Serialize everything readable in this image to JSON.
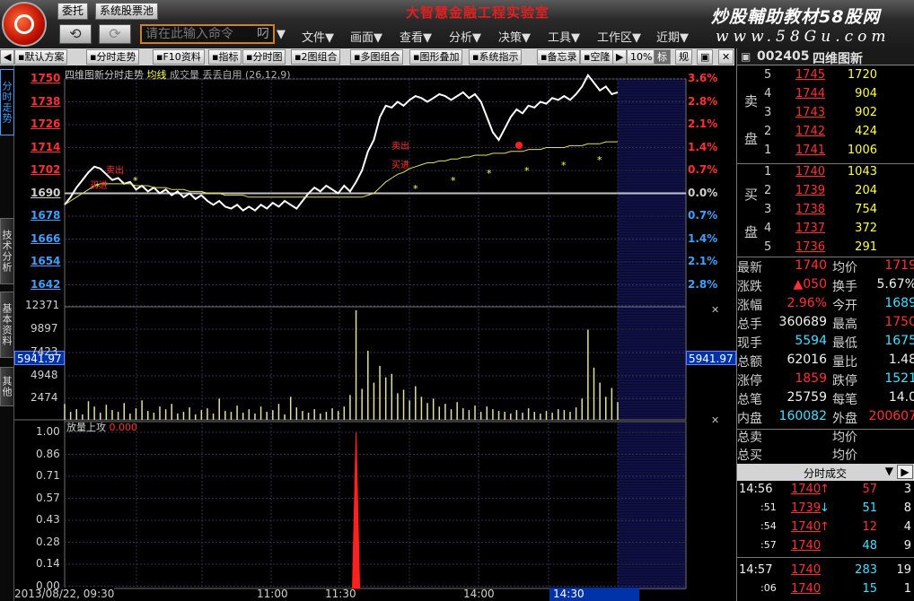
{
  "app": {
    "title": "大智慧金融工程实验室",
    "brand_cn": "炒股輔助教材58股网",
    "brand_url": "www.58Gu.com",
    "top_buttons": [
      "委托",
      "系统股票池"
    ],
    "command_placeholder": "请在此输入命令",
    "command_suffix": "叼",
    "menu": [
      "文件▼",
      "画面▼",
      "查看▼",
      "分析▼",
      "决策▼",
      "工具▼",
      "工作区▼",
      "近期▼"
    ]
  },
  "toolbar": {
    "items": [
      "默认方案",
      "分时走势",
      "F10资料",
      "指标",
      "分时图",
      "2图组合",
      "多图组合",
      "图形叠加",
      "系统指示",
      "备忘录",
      "空隆",
      "10%",
      "标",
      "规"
    ]
  },
  "vtabs": [
    "分时走势",
    "技术分析",
    "基本资料",
    "其他"
  ],
  "chart": {
    "header": {
      "title": "四维图新分时走势",
      "avg_label": "均线",
      "vol_label": "成交量",
      "indicator": "丢丢自用 (26,12,9)"
    },
    "price_labels": [
      "1750",
      "1738",
      "1726",
      "1714",
      "1702",
      "1690",
      "1678",
      "1666",
      "1654",
      "1642"
    ],
    "pct_labels": [
      "3.6%",
      "2.8%",
      "2.1%",
      "1.4%",
      "0.7%",
      "0.0%",
      "0.7%",
      "1.4%",
      "2.1%",
      "2.8%"
    ],
    "vol_labels": [
      "12371",
      "9897",
      "7423",
      "4948",
      "2474"
    ],
    "cursor_vol": "5941.97",
    "indicator_name": "放量上攻",
    "indicator_value": "0.000",
    "ind_labels": [
      "1.00",
      "0.86",
      "0.71",
      "0.57",
      "0.43",
      "0.28",
      "0.14",
      "0.00"
    ],
    "time_labels": [
      "2013/08/22, 09:30",
      "11:00",
      "11:30",
      "14:00",
      "14:30"
    ],
    "trade_marks": [
      "卖出",
      "买进",
      "卖出",
      "买进"
    ]
  },
  "chart_data": {
    "type": "line",
    "title": "四维图新分时走势",
    "prev_close": 1690,
    "ylim": [
      1638,
      1752
    ],
    "series": [
      {
        "name": "价格",
        "values": [
          1684,
          1688,
          1693,
          1697,
          1701,
          1704,
          1703,
          1700,
          1697,
          1698,
          1695,
          1696,
          1692,
          1694,
          1691,
          1693,
          1690,
          1692,
          1689,
          1691,
          1688,
          1690,
          1687,
          1689,
          1686,
          1684,
          1686,
          1683,
          1682,
          1684,
          1681,
          1683,
          1681,
          1684,
          1682,
          1685,
          1683,
          1686,
          1684,
          1682,
          1686,
          1690,
          1693,
          1691,
          1694,
          1692,
          1690,
          1694,
          1691,
          1696,
          1702,
          1712,
          1718,
          1730,
          1736,
          1735,
          1738,
          1736,
          1739,
          1741,
          1740,
          1738,
          1740,
          1742,
          1741,
          1739,
          1741,
          1743,
          1740,
          1742,
          1738,
          1730,
          1722,
          1718,
          1724,
          1730,
          1734,
          1732,
          1736,
          1735,
          1738,
          1737,
          1740,
          1739,
          1741,
          1739,
          1742,
          1746,
          1752,
          1748,
          1744,
          1746,
          1742,
          1743
        ]
      },
      {
        "name": "均线",
        "values": [
          1684,
          1686,
          1688,
          1690,
          1692,
          1694,
          1695,
          1695,
          1695,
          1695,
          1695,
          1695,
          1694,
          1694,
          1694,
          1693,
          1693,
          1693,
          1692,
          1692,
          1692,
          1691,
          1691,
          1691,
          1690,
          1690,
          1690,
          1689,
          1689,
          1689,
          1689,
          1688,
          1688,
          1688,
          1688,
          1688,
          1688,
          1688,
          1688,
          1688,
          1688,
          1688,
          1688,
          1688,
          1688,
          1688,
          1688,
          1688,
          1688,
          1688,
          1688,
          1689,
          1690,
          1693,
          1696,
          1698,
          1700,
          1701,
          1703,
          1704,
          1705,
          1706,
          1706,
          1707,
          1707,
          1708,
          1708,
          1709,
          1709,
          1710,
          1710,
          1710,
          1711,
          1711,
          1711,
          1712,
          1712,
          1712,
          1713,
          1713,
          1713,
          1714,
          1714,
          1714,
          1714,
          1715,
          1715,
          1715,
          1716,
          1716,
          1716,
          1717,
          1717,
          1717
        ]
      }
    ],
    "volume": [
      1800,
      900,
      1200,
      600,
      2100,
      1500,
      800,
      1700,
      1100,
      900,
      1900,
      700,
      1300,
      2200,
      1000,
      800,
      1500,
      1200,
      1800,
      700,
      900,
      1400,
      600,
      1100,
      1300,
      700,
      2400,
      1000,
      900,
      1600,
      800,
      1200,
      700,
      1500,
      900,
      1100,
      1800,
      600,
      2600,
      1400,
      1000,
      800,
      1200,
      700,
      900,
      1300,
      1000,
      1500,
      2800,
      12371,
      3500,
      7800,
      4200,
      6100,
      4800,
      5200,
      3000,
      3400,
      2200,
      3800,
      2600,
      1900,
      2400,
      1500,
      1800,
      1200,
      2000,
      1300,
      1100,
      1600,
      900,
      1500,
      1200,
      1000,
      900,
      700,
      1100,
      800,
      1300,
      900,
      700,
      1000,
      800,
      1200,
      1100,
      900,
      1400,
      2400,
      10200,
      5900,
      4200,
      2600,
      3600,
      2000
    ],
    "indicator_spike": {
      "index": 49,
      "value": 1.0
    }
  },
  "quote": {
    "code": "002405",
    "name": "四维图新",
    "sell_side_label": "卖盘",
    "buy_side_label": "买盘",
    "asks": [
      {
        "level": "5",
        "price": "1745",
        "vol": "1720"
      },
      {
        "level": "4",
        "price": "1744",
        "vol": "904"
      },
      {
        "level": "3",
        "price": "1743",
        "vol": "902"
      },
      {
        "level": "2",
        "price": "1742",
        "vol": "424"
      },
      {
        "level": "1",
        "price": "1741",
        "vol": "1006"
      }
    ],
    "bids": [
      {
        "level": "1",
        "price": "1740",
        "vol": "1043"
      },
      {
        "level": "2",
        "price": "1739",
        "vol": "204"
      },
      {
        "level": "3",
        "price": "1738",
        "vol": "754"
      },
      {
        "level": "4",
        "price": "1737",
        "vol": "372"
      },
      {
        "level": "5",
        "price": "1736",
        "vol": "291"
      }
    ],
    "stats": [
      {
        "k1": "最新",
        "v1": "1740",
        "c1": "red",
        "k2": "均价",
        "v2": "1719",
        "c2": "red"
      },
      {
        "k1": "涨跌",
        "v1": "▲050",
        "c1": "red",
        "k2": "换手",
        "v2": "5.67%",
        "c2": "wht"
      },
      {
        "k1": "涨幅",
        "v1": "2.96%",
        "c1": "red",
        "k2": "今开",
        "v2": "1689",
        "c2": "cyn"
      },
      {
        "k1": "总手",
        "v1": "360689",
        "c1": "wht",
        "k2": "最高",
        "v2": "1750",
        "c2": "red"
      },
      {
        "k1": "现手",
        "v1": "5594",
        "c1": "cyn",
        "k2": "最低",
        "v2": "1675",
        "c2": "cyn"
      },
      {
        "k1": "总额",
        "v1": "62016",
        "c1": "wht",
        "k2": "量比",
        "v2": "1.48",
        "c2": "wht"
      },
      {
        "k1": "涨停",
        "v1": "1859",
        "c1": "red",
        "k2": "跌停",
        "v2": "1521",
        "c2": "cyn"
      },
      {
        "k1": "总笔",
        "v1": "25759",
        "c1": "wht",
        "k2": "每笔",
        "v2": "14.0",
        "c2": "wht"
      },
      {
        "k1": "内盘",
        "v1": "160082",
        "c1": "cyn",
        "k2": "外盘",
        "v2": "200607",
        "c2": "red"
      }
    ],
    "extra": [
      {
        "k1": "总卖",
        "k2": "均价"
      },
      {
        "k1": "总买",
        "k2": "均价"
      }
    ],
    "ticks_title": "分时成交",
    "ticks": [
      {
        "time": "14:56",
        "price": "1740",
        "arrow": "↑",
        "arrow_c": "red",
        "vol": "57",
        "vol_c": "red",
        "n": "3"
      },
      {
        "time": ":51",
        "price": "1739",
        "arrow": "↓",
        "arrow_c": "cyn",
        "vol": "51",
        "vol_c": "cyn",
        "n": "8"
      },
      {
        "time": ":54",
        "price": "1740",
        "arrow": "↑",
        "arrow_c": "red",
        "vol": "12",
        "vol_c": "red",
        "n": "4"
      },
      {
        "time": ":57",
        "price": "1740",
        "arrow": "",
        "arrow_c": "red",
        "vol": "48",
        "vol_c": "cyn",
        "n": "9"
      },
      {
        "time": "14:57",
        "price": "1740",
        "arrow": "",
        "arrow_c": "red",
        "vol": "283",
        "vol_c": "cyn",
        "n": "19"
      },
      {
        "time": ":06",
        "price": "1740",
        "arrow": "",
        "arrow_c": "red",
        "vol": "15",
        "vol_c": "cyn",
        "n": "1"
      }
    ]
  }
}
